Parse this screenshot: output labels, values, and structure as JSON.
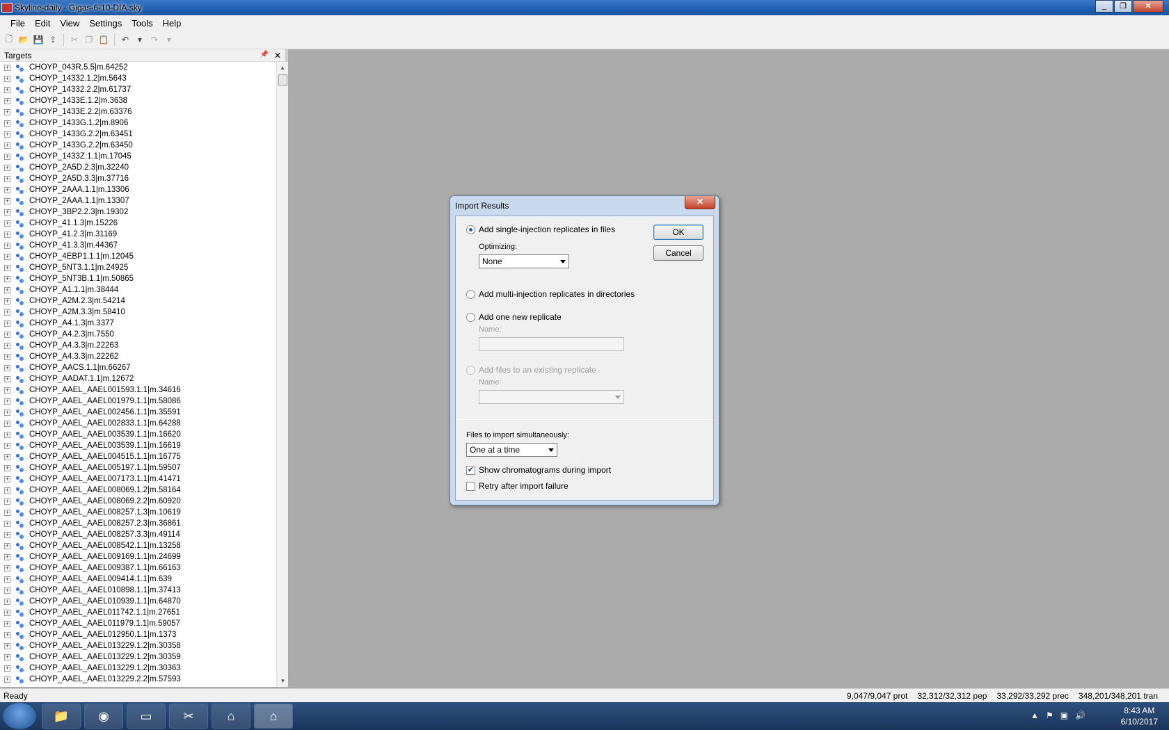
{
  "window": {
    "title": "Skyline-daily - Gigas-6-10-DIA.sky",
    "minimize": "_",
    "restore": "❐",
    "close": "✕"
  },
  "menu": [
    "File",
    "Edit",
    "View",
    "Settings",
    "Tools",
    "Help"
  ],
  "targets_panel": {
    "title": "Targets",
    "pin": "📌",
    "close": "✕",
    "items": [
      "CHOYP_043R.5.5|m.64252",
      "CHOYP_14332.1.2|m.5643",
      "CHOYP_14332.2.2|m.61737",
      "CHOYP_1433E.1.2|m.3638",
      "CHOYP_1433E.2.2|m.63376",
      "CHOYP_1433G.1.2|m.8906",
      "CHOYP_1433G.2.2|m.63451",
      "CHOYP_1433G.2.2|m.63450",
      "CHOYP_1433Z.1.1|m.17045",
      "CHOYP_2A5D.2.3|m.32240",
      "CHOYP_2A5D.3.3|m.37716",
      "CHOYP_2AAA.1.1|m.13306",
      "CHOYP_2AAA.1.1|m.13307",
      "CHOYP_3BP2.2.3|m.19302",
      "CHOYP_41.1.3|m.15226",
      "CHOYP_41.2.3|m.31169",
      "CHOYP_41.3.3|m.44367",
      "CHOYP_4EBP1.1.1|m.12045",
      "CHOYP_5NT3.1.1|m.24925",
      "CHOYP_5NT3B.1.1|m.50865",
      "CHOYP_A1.1.1|m.38444",
      "CHOYP_A2M.2.3|m.54214",
      "CHOYP_A2M.3.3|m.58410",
      "CHOYP_A4.1.3|m.3377",
      "CHOYP_A4.2.3|m.7550",
      "CHOYP_A4.3.3|m.22263",
      "CHOYP_A4.3.3|m.22262",
      "CHOYP_AACS.1.1|m.66267",
      "CHOYP_AADAT.1.1|m.12672",
      "CHOYP_AAEL_AAEL001593.1.1|m.34616",
      "CHOYP_AAEL_AAEL001979.1.1|m.58086",
      "CHOYP_AAEL_AAEL002456.1.1|m.35591",
      "CHOYP_AAEL_AAEL002833.1.1|m.64288",
      "CHOYP_AAEL_AAEL003539.1.1|m.16620",
      "CHOYP_AAEL_AAEL003539.1.1|m.16619",
      "CHOYP_AAEL_AAEL004515.1.1|m.16775",
      "CHOYP_AAEL_AAEL005197.1.1|m.59507",
      "CHOYP_AAEL_AAEL007173.1.1|m.41471",
      "CHOYP_AAEL_AAEL008069.1.2|m.58164",
      "CHOYP_AAEL_AAEL008069.2.2|m.60920",
      "CHOYP_AAEL_AAEL008257.1.3|m.10619",
      "CHOYP_AAEL_AAEL008257.2.3|m.36861",
      "CHOYP_AAEL_AAEL008257.3.3|m.49114",
      "CHOYP_AAEL_AAEL008542.1.1|m.13258",
      "CHOYP_AAEL_AAEL009169.1.1|m.24699",
      "CHOYP_AAEL_AAEL009387.1.1|m.66163",
      "CHOYP_AAEL_AAEL009414.1.1|m.639",
      "CHOYP_AAEL_AAEL010898.1.1|m.37413",
      "CHOYP_AAEL_AAEL010939.1.1|m.64870",
      "CHOYP_AAEL_AAEL011742.1.1|m.27651",
      "CHOYP_AAEL_AAEL011979.1.1|m.59057",
      "CHOYP_AAEL_AAEL012950.1.1|m.1373",
      "CHOYP_AAEL_AAEL013229.1.2|m.30358",
      "CHOYP_AAEL_AAEL013229.1.2|m.30359",
      "CHOYP_AAEL_AAEL013229.1.2|m.30363",
      "CHOYP_AAEL_AAEL013229.2.2|m.57593"
    ]
  },
  "dialog": {
    "title": "Import Results",
    "close": "✕",
    "opt_single": "Add single-injection replicates in files",
    "optimizing_label": "Optimizing:",
    "optimizing_value": "None",
    "opt_multi": "Add multi-injection replicates in directories",
    "opt_new": "Add one new replicate",
    "new_name_label": "Name:",
    "opt_existing": "Add files to an existing replicate",
    "existing_name_label": "Name:",
    "ok": "OK",
    "cancel": "Cancel",
    "files_label": "Files to import simultaneously:",
    "files_value": "One at a time",
    "show_chrom": "Show chromatograms during import",
    "show_chrom_checked": true,
    "retry": "Retry after import failure",
    "retry_checked": false
  },
  "status": {
    "ready": "Ready",
    "prot": "9,047/9,047 prot",
    "pep": "32,312/32,312 pep",
    "prec": "33,292/33,292 prec",
    "tran": "348,201/348,201 tran"
  },
  "taskbar": {
    "time": "8:43 AM",
    "date": "6/10/2017",
    "apps": [
      "windows-explorer",
      "chrome",
      "command-prompt",
      "skyline-tool",
      "skyline",
      "skyline-daily"
    ]
  }
}
